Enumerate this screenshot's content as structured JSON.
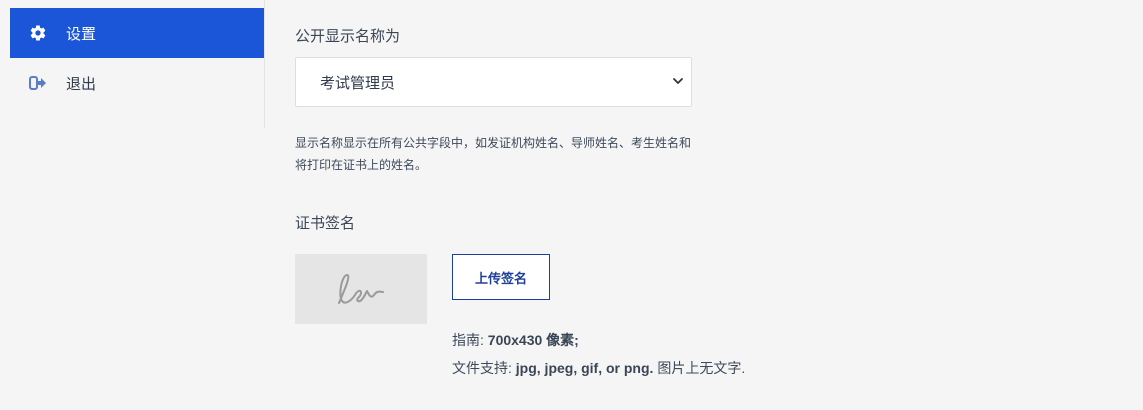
{
  "sidebar": {
    "items": [
      {
        "label": "设置",
        "icon": "gear-icon",
        "active": true
      },
      {
        "label": "退出",
        "icon": "logout-icon",
        "active": false
      }
    ]
  },
  "display_name": {
    "label": "公开显示名称为",
    "selected": "考试管理员",
    "help_line1": "显示名称显示在所有公共字段中，如发证机构姓名、导师姓名、考生姓名和",
    "help_line2": "将打印在证书上的姓名。"
  },
  "signature": {
    "label": "证书签名",
    "upload_label": "上传签名",
    "guide_prefix": "指南: ",
    "guide_value": "700x430 像素;",
    "formats_prefix": "文件支持: ",
    "formats_value": "jpg, jpeg, gif, or png.",
    "formats_suffix": " 图片上无文字."
  },
  "colors": {
    "accent": "#1b56d9",
    "button_border": "#1f3f9a",
    "background": "#f5f5f5"
  }
}
